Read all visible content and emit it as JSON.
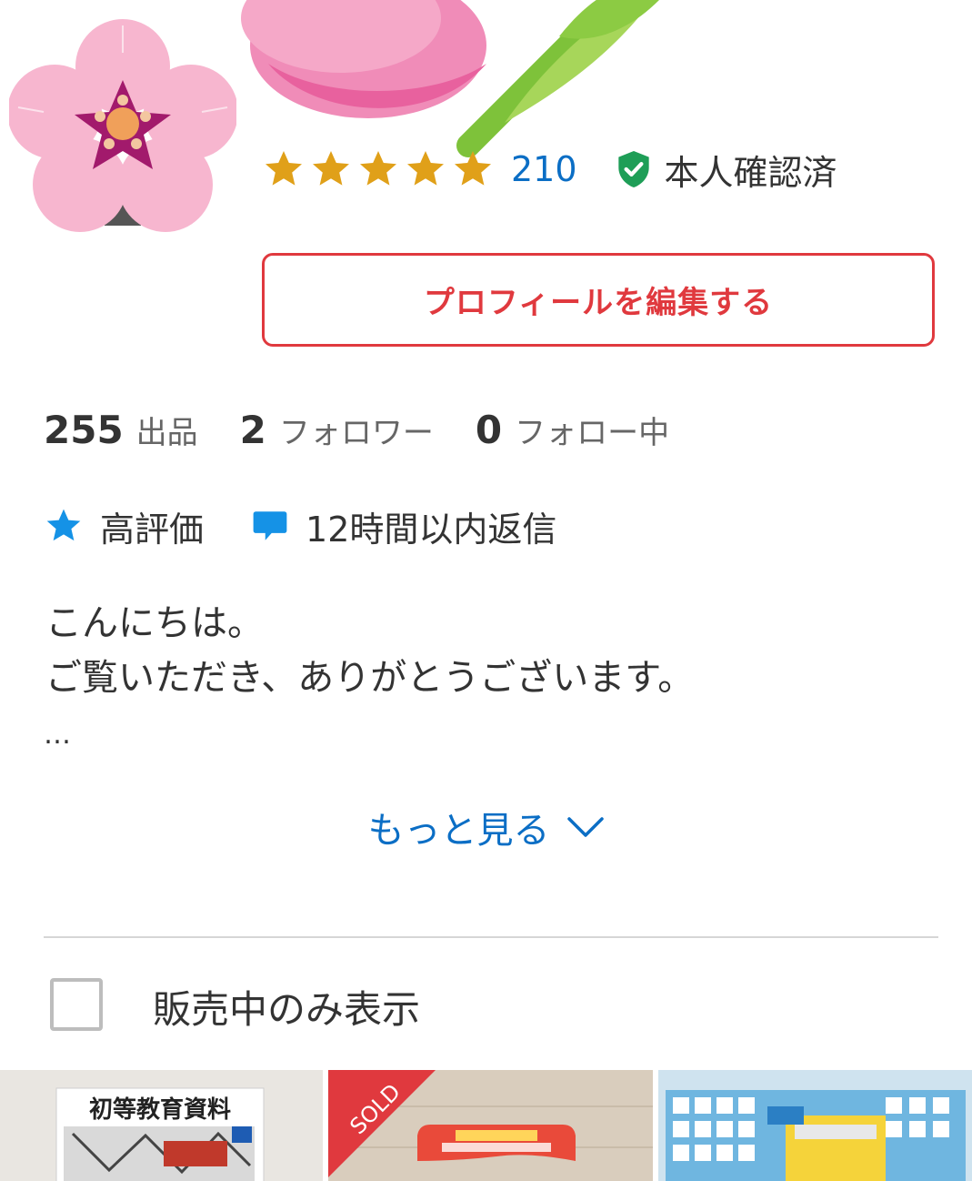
{
  "profile": {
    "rating_count": "210",
    "stars": 5,
    "verified_label": "本人確認済",
    "edit_button_label": "プロフィールを編集する"
  },
  "stats": [
    {
      "count": "255",
      "label": "出品"
    },
    {
      "count": "2",
      "label": "フォロワー"
    },
    {
      "count": "0",
      "label": "フォロー中"
    }
  ],
  "badges": {
    "high_rating": "高評価",
    "reply_time": "12時間以内返信"
  },
  "bio": {
    "line1": "こんにちは。",
    "line2": "ご覧いただき、ありがとうございます。",
    "ellipsis": "…"
  },
  "show_more_label": "もっと見る",
  "filter": {
    "label": "販売中のみ表示",
    "checked": false
  },
  "items": [
    {
      "title_text": "初等教育資料",
      "sold": false
    },
    {
      "sold_label": "SOLD",
      "sold": true
    },
    {
      "sold": false
    }
  ],
  "colors": {
    "accent_red": "#e0393e",
    "link_blue": "#0b6ec5",
    "star_gold": "#e0a019",
    "verify_green": "#1e9e57",
    "badge_blue": "#1592e6"
  }
}
